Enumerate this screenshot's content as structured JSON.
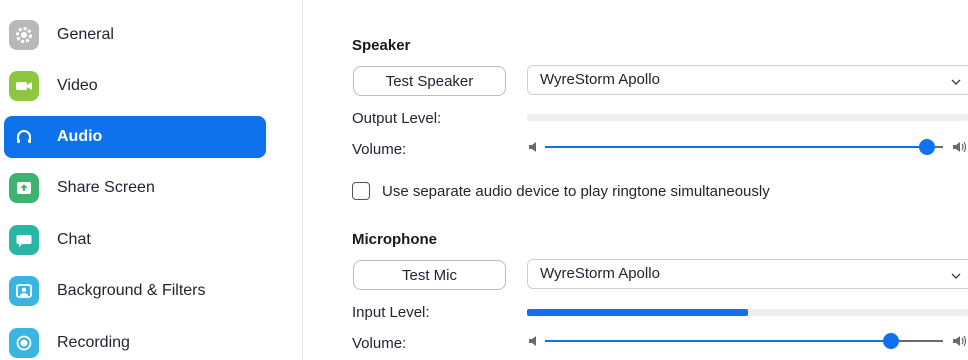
{
  "sidebar": {
    "items": [
      {
        "label": "General",
        "icon": "gear-icon",
        "color": "#b0b0b0"
      },
      {
        "label": "Video",
        "icon": "video-camera-icon",
        "color": "#8dc63f"
      },
      {
        "label": "Audio",
        "icon": "headphones-icon",
        "color": "#0e72ed",
        "active": true
      },
      {
        "label": "Share Screen",
        "icon": "share-screen-icon",
        "color": "#3cb371"
      },
      {
        "label": "Chat",
        "icon": "chat-bubble-icon",
        "color": "#2ab5a5"
      },
      {
        "label": "Background & Filters",
        "icon": "background-person-icon",
        "color": "#3ab4e0"
      },
      {
        "label": "Recording",
        "icon": "record-icon",
        "color": "#3ab4e0"
      }
    ]
  },
  "speaker": {
    "title": "Speaker",
    "test_button": "Test Speaker",
    "device": "WyreStorm Apollo",
    "output_level_label": "Output Level:",
    "output_level": 0.0,
    "volume_label": "Volume:",
    "volume": 0.96
  },
  "ringtone_option": {
    "label": "Use separate audio device to play ringtone simultaneously",
    "checked": false
  },
  "microphone": {
    "title": "Microphone",
    "test_button": "Test Mic",
    "device": "WyreStorm Apollo",
    "input_level_label": "Input Level:",
    "input_level": 0.5,
    "volume_label": "Volume:",
    "volume": 0.87
  },
  "colors": {
    "accent": "#0e72ed"
  }
}
